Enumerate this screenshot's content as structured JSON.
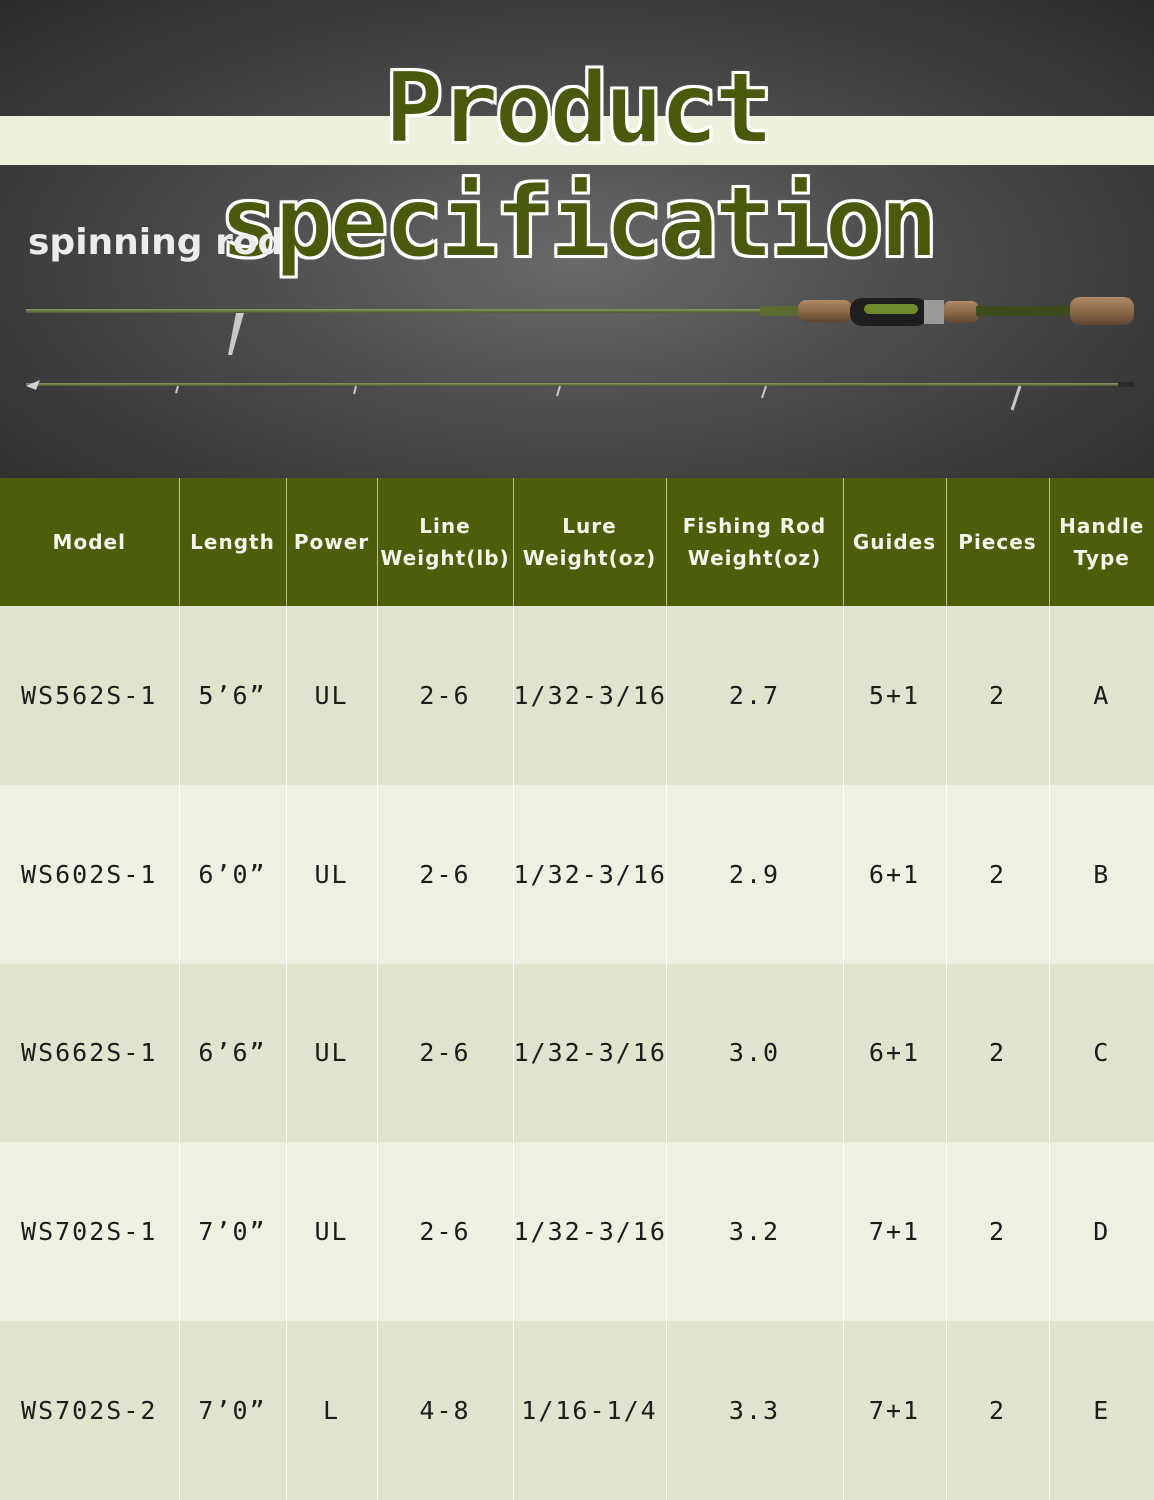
{
  "header": {
    "title": "Product specification",
    "subtitle": "spinning rod"
  },
  "colors": {
    "accent": "#4d5e0a",
    "row_odd": "#e1e3cf",
    "row_even": "#eef0e2"
  },
  "table": {
    "headers": [
      {
        "line1": "Model",
        "line2": ""
      },
      {
        "line1": "Length",
        "line2": ""
      },
      {
        "line1": "Power",
        "line2": ""
      },
      {
        "line1": "Line",
        "line2": "Weight(lb)"
      },
      {
        "line1": "Lure",
        "line2": "Weight(oz)"
      },
      {
        "line1": "Fishing Rod",
        "line2": "Weight(oz)"
      },
      {
        "line1": "Guides",
        "line2": ""
      },
      {
        "line1": "Pieces",
        "line2": ""
      },
      {
        "line1": "Handle",
        "line2": "Type"
      }
    ],
    "rows": [
      [
        "WS562S-1",
        "5’6”",
        "UL",
        "2-6",
        "1/32-3/16",
        "2.7",
        "5+1",
        "2",
        "A"
      ],
      [
        "WS602S-1",
        "6’0”",
        "UL",
        "2-6",
        "1/32-3/16",
        "2.9",
        "6+1",
        "2",
        "B"
      ],
      [
        "WS662S-1",
        "6’6”",
        "UL",
        "2-6",
        "1/32-3/16",
        "3.0",
        "6+1",
        "2",
        "C"
      ],
      [
        "WS702S-1",
        "7’0”",
        "UL",
        "2-6",
        "1/32-3/16",
        "3.2",
        "7+1",
        "2",
        "D"
      ],
      [
        "WS702S-2",
        "7’0”",
        "L",
        "4-8",
        "1/16-1/4",
        "3.3",
        "7+1",
        "2",
        "E"
      ]
    ]
  }
}
